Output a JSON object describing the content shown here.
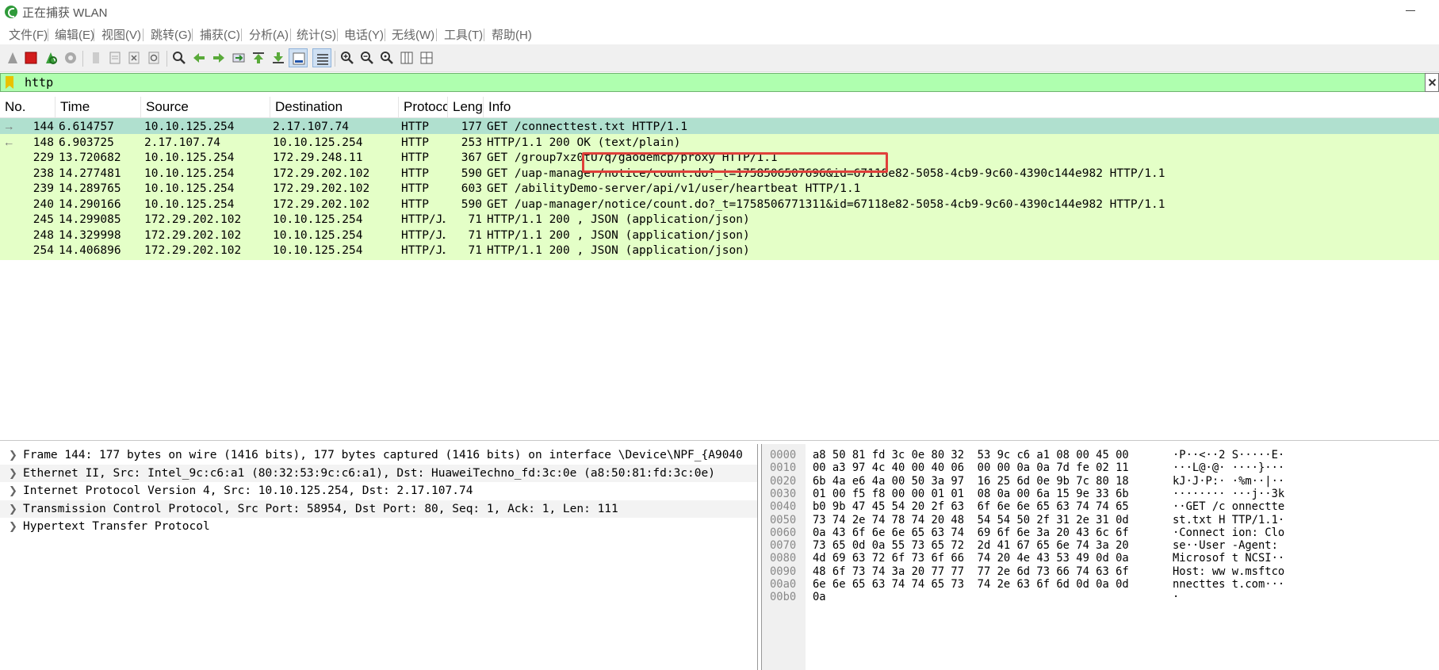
{
  "window": {
    "title": "正在捕获 WLAN"
  },
  "menu": [
    "文件(F)",
    "编辑(E)",
    "视图(V)",
    "跳转(G)",
    "捕获(C)",
    "分析(A)",
    "统计(S)",
    "电话(Y)",
    "无线(W)",
    "工具(T)",
    "帮助(H)"
  ],
  "toolbar": {
    "buttons": [
      "start-capture-icon",
      "stop-capture-icon",
      "restart-capture-icon",
      "capture-options-icon",
      "open-file-icon",
      "save-file-icon",
      "close-file-icon",
      "reload-file-icon",
      "find-packet-icon",
      "go-back-icon",
      "go-forward-icon",
      "go-to-packet-icon",
      "go-first-icon",
      "go-last-icon",
      "auto-scroll-icon",
      "colorize-icon",
      "zoom-in-icon",
      "zoom-out-icon",
      "zoom-normal-icon",
      "resize-columns-icon",
      "layout-icon"
    ]
  },
  "filter": {
    "value": "http"
  },
  "packet_list": {
    "columns": [
      "No.",
      "Time",
      "Source",
      "Destination",
      "Protoco",
      "Lengt",
      "Info"
    ],
    "rows": [
      {
        "no": "144",
        "time": "6.614757",
        "source": "10.10.125.254",
        "destination": "2.17.107.74",
        "protocol": "HTTP",
        "length": "177",
        "info": "GET /connecttest.txt HTTP/1.1",
        "selected": true,
        "marker": "→"
      },
      {
        "no": "148",
        "time": "6.903725",
        "source": "2.17.107.74",
        "destination": "10.10.125.254",
        "protocol": "HTTP",
        "length": "253",
        "info": "HTTP/1.1 200 OK  (text/plain)",
        "selected": false,
        "marker": "←"
      },
      {
        "no": "229",
        "time": "13.720682",
        "source": "10.10.125.254",
        "destination": "172.29.248.11",
        "protocol": "HTTP",
        "length": "367",
        "info": "GET  /group7xz0tU7q/gaodemcp/proxy HTTP/1.1",
        "selected": false,
        "marker": ""
      },
      {
        "no": "238",
        "time": "14.277481",
        "source": "10.10.125.254",
        "destination": "172.29.202.102",
        "protocol": "HTTP",
        "length": "590",
        "info": "GET /uap-manager/notice/count.do?_t=1758506507696&id=67118e82-5058-4cb9-9c60-4390c144e982 HTTP/1.1",
        "selected": false,
        "marker": ""
      },
      {
        "no": "239",
        "time": "14.289765",
        "source": "10.10.125.254",
        "destination": "172.29.202.102",
        "protocol": "HTTP",
        "length": "603",
        "info": "GET /abilityDemo-server/api/v1/user/heartbeat HTTP/1.1",
        "selected": false,
        "marker": ""
      },
      {
        "no": "240",
        "time": "14.290166",
        "source": "10.10.125.254",
        "destination": "172.29.202.102",
        "protocol": "HTTP",
        "length": "590",
        "info": "GET /uap-manager/notice/count.do?_t=1758506771311&id=67118e82-5058-4cb9-9c60-4390c144e982 HTTP/1.1",
        "selected": false,
        "marker": ""
      },
      {
        "no": "245",
        "time": "14.299085",
        "source": "172.29.202.102",
        "destination": "10.10.125.254",
        "protocol": "HTTP/J…",
        "length": "71",
        "info": "HTTP/1.1 200  , JSON (application/json)",
        "selected": false,
        "marker": ""
      },
      {
        "no": "248",
        "time": "14.329998",
        "source": "172.29.202.102",
        "destination": "10.10.125.254",
        "protocol": "HTTP/J…",
        "length": "71",
        "info": "HTTP/1.1 200  , JSON (application/json)",
        "selected": false,
        "marker": ""
      },
      {
        "no": "254",
        "time": "14.406896",
        "source": "172.29.202.102",
        "destination": "10.10.125.254",
        "protocol": "HTTP/J…",
        "length": "71",
        "info": "HTTP/1.1 200  , JSON (application/json)",
        "selected": false,
        "marker": ""
      }
    ]
  },
  "details": [
    "Frame 144: 177 bytes on wire (1416 bits), 177 bytes captured (1416 bits) on interface \\Device\\NPF_{A9040",
    "Ethernet II, Src: Intel_9c:c6:a1 (80:32:53:9c:c6:a1), Dst: HuaweiTechno_fd:3c:0e (a8:50:81:fd:3c:0e)",
    "Internet Protocol Version 4, Src: 10.10.125.254, Dst: 2.17.107.74",
    "Transmission Control Protocol, Src Port: 58954, Dst Port: 80, Seq: 1, Ack: 1, Len: 111",
    "Hypertext Transfer Protocol"
  ],
  "bytes": [
    {
      "offset": "0000",
      "hex": "a8 50 81 fd 3c 0e 80 32  53 9c c6 a1 08 00 45 00",
      "ascii": "·P··<··2 S·····E·"
    },
    {
      "offset": "0010",
      "hex": "00 a3 97 4c 40 00 40 06  00 00 0a 0a 7d fe 02 11",
      "ascii": "···L@·@· ····}···"
    },
    {
      "offset": "0020",
      "hex": "6b 4a e6 4a 00 50 3a 97  16 25 6d 0e 9b 7c 80 18",
      "ascii": "kJ·J·P:· ·%m··|··"
    },
    {
      "offset": "0030",
      "hex": "01 00 f5 f8 00 00 01 01  08 0a 00 6a 15 9e 33 6b",
      "ascii": "········ ···j··3k"
    },
    {
      "offset": "0040",
      "hex": "b0 9b 47 45 54 20 2f 63  6f 6e 6e 65 63 74 74 65",
      "ascii": "··GET /c onnectte"
    },
    {
      "offset": "0050",
      "hex": "73 74 2e 74 78 74 20 48  54 54 50 2f 31 2e 31 0d",
      "ascii": "st.txt H TTP/1.1·"
    },
    {
      "offset": "0060",
      "hex": "0a 43 6f 6e 6e 65 63 74  69 6f 6e 3a 20 43 6c 6f",
      "ascii": "·Connect ion: Clo"
    },
    {
      "offset": "0070",
      "hex": "73 65 0d 0a 55 73 65 72  2d 41 67 65 6e 74 3a 20",
      "ascii": "se··User -Agent: "
    },
    {
      "offset": "0080",
      "hex": "4d 69 63 72 6f 73 6f 66  74 20 4e 43 53 49 0d 0a",
      "ascii": "Microsof t NCSI··"
    },
    {
      "offset": "0090",
      "hex": "48 6f 73 74 3a 20 77 77  77 2e 6d 73 66 74 63 6f",
      "ascii": "Host: ww w.msftco"
    },
    {
      "offset": "00a0",
      "hex": "6e 6e 65 63 74 74 65 73  74 2e 63 6f 6d 0d 0a 0d",
      "ascii": "nnecttes t.com···"
    },
    {
      "offset": "00b0",
      "hex": "0a",
      "ascii": "·"
    }
  ],
  "colors": {
    "row_bg": "#e4ffc7",
    "selected_row_bg": "#b0e0cf",
    "filter_bg": "#afffaf",
    "highlight_box": "#e0403a"
  }
}
